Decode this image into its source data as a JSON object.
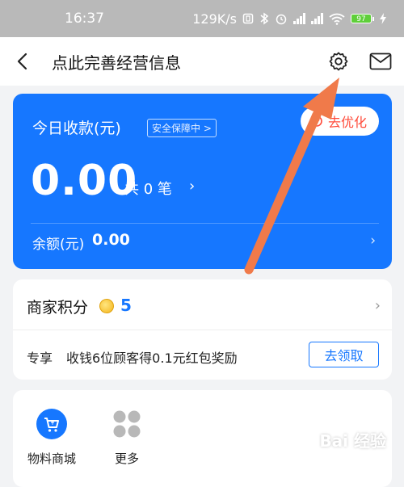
{
  "status_bar": {
    "time": "16:37",
    "network_speed": "129K/s",
    "battery_level": "97"
  },
  "nav": {
    "title": "点此完善经营信息",
    "icons": [
      "back-arrow-icon",
      "gear-icon",
      "mail-icon"
    ]
  },
  "revenue_card": {
    "label": "今日收款(元)",
    "safety_tag": "安全保障中 >",
    "optimize_button": "去优化",
    "amount": "0.00",
    "count_text": "共 0 笔",
    "balance_label": "余额(元)",
    "balance_value": "0.00",
    "background_color": "#1677ff"
  },
  "points_card": {
    "label": "商家积分",
    "value": "5",
    "promo_tag": "专享",
    "promo_text": "收钱6位顾客得0.1元红包奖励",
    "claim_button": "去领取"
  },
  "grid": {
    "items": [
      {
        "label": "物料商城",
        "icon": "shopping-cart-icon"
      },
      {
        "label": "更多",
        "icon": "grid-more-icon"
      }
    ]
  },
  "watermark": "Bai 经验",
  "annotation_color": "#f07a4a"
}
